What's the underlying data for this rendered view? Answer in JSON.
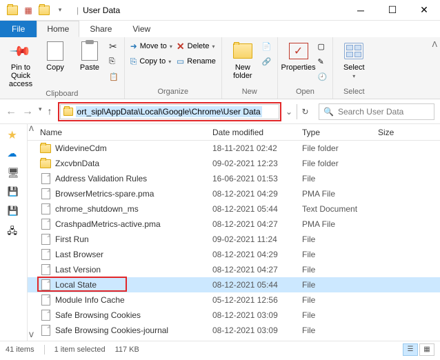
{
  "window": {
    "title": "User Data"
  },
  "tabs": {
    "file": "File",
    "home": "Home",
    "share": "Share",
    "view": "View"
  },
  "ribbon": {
    "clipboard": {
      "label": "Clipboard",
      "pin": "Pin to Quick access",
      "copy": "Copy",
      "paste": "Paste"
    },
    "organize": {
      "label": "Organize",
      "moveto": "Move to",
      "copyto": "Copy to",
      "delete": "Delete",
      "rename": "Rename"
    },
    "new": {
      "label": "New",
      "newfolder": "New folder"
    },
    "open": {
      "label": "Open",
      "properties": "Properties"
    },
    "select": {
      "label": "Select",
      "select": "Select"
    }
  },
  "address": {
    "path": "ort_sipl\\AppData\\Local\\Google\\Chrome\\User Data"
  },
  "search": {
    "placeholder": "Search User Data"
  },
  "columns": {
    "name": "Name",
    "date": "Date modified",
    "type": "Type",
    "size": "Size"
  },
  "files": [
    {
      "name": "WidevineCdm",
      "date": "18-11-2021 02:42",
      "type": "File folder",
      "kind": "folder"
    },
    {
      "name": "ZxcvbnData",
      "date": "09-02-2021 12:23",
      "type": "File folder",
      "kind": "folder"
    },
    {
      "name": "Address Validation Rules",
      "date": "16-06-2021 01:53",
      "type": "File",
      "kind": "file"
    },
    {
      "name": "BrowserMetrics-spare.pma",
      "date": "08-12-2021 04:29",
      "type": "PMA File",
      "kind": "file"
    },
    {
      "name": "chrome_shutdown_ms",
      "date": "08-12-2021 05:44",
      "type": "Text Document",
      "kind": "file"
    },
    {
      "name": "CrashpadMetrics-active.pma",
      "date": "08-12-2021 04:27",
      "type": "PMA File",
      "kind": "file"
    },
    {
      "name": "First Run",
      "date": "09-02-2021 11:24",
      "type": "File",
      "kind": "file"
    },
    {
      "name": "Last Browser",
      "date": "08-12-2021 04:29",
      "type": "File",
      "kind": "file"
    },
    {
      "name": "Last Version",
      "date": "08-12-2021 04:27",
      "type": "File",
      "kind": "file"
    },
    {
      "name": "Local State",
      "date": "08-12-2021 05:44",
      "type": "File",
      "kind": "file",
      "selected": true,
      "highlight": true
    },
    {
      "name": "Module Info Cache",
      "date": "05-12-2021 12:56",
      "type": "File",
      "kind": "file"
    },
    {
      "name": "Safe Browsing Cookies",
      "date": "08-12-2021 03:09",
      "type": "File",
      "kind": "file"
    },
    {
      "name": "Safe Browsing Cookies-journal",
      "date": "08-12-2021 03:09",
      "type": "File",
      "kind": "file"
    }
  ],
  "status": {
    "items": "41 items",
    "selected": "1 item selected",
    "size": "117 KB"
  }
}
